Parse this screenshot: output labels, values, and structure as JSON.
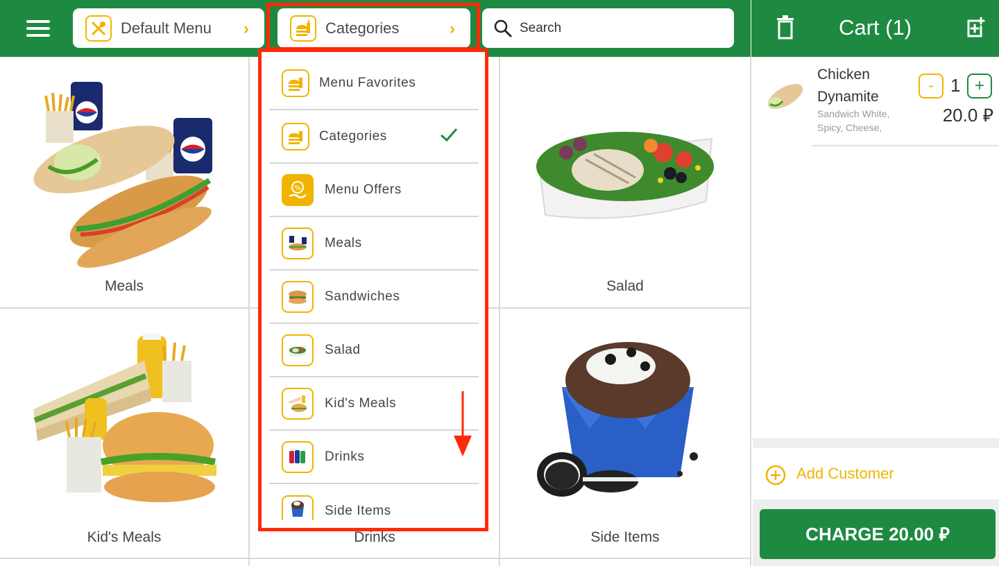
{
  "header": {
    "menu_selector": {
      "label": "Default Menu",
      "icon": "utensils-icon"
    },
    "category_selector": {
      "label": "Categories",
      "icon": "burger-drink-icon"
    },
    "search": {
      "placeholder": "Search"
    }
  },
  "cart": {
    "title": "Cart (1)",
    "items": [
      {
        "name": "Chicken Dynamite",
        "modifiers": "Sandwich White, Spicy, Cheese,",
        "quantity": "1",
        "price": "20.0 ⃁",
        "minus_label": "-",
        "plus_label": "+"
      }
    ],
    "add_customer": "Add Customer",
    "charge_label": "CHARGE 20.00 ⃁"
  },
  "tiles": [
    {
      "label": "Meals"
    },
    {
      "label": ""
    },
    {
      "label": "Salad"
    },
    {
      "label": "Kid's Meals"
    },
    {
      "label": "Drinks"
    },
    {
      "label": "Side Items"
    }
  ],
  "dropdown": {
    "items": [
      {
        "label": "Menu Favorites",
        "icon": "burger-drink-icon",
        "selected": false
      },
      {
        "label": "Categories",
        "icon": "burger-drink-icon",
        "selected": true
      },
      {
        "label": "Menu Offers",
        "icon": "percent-hand-icon",
        "selected": false
      },
      {
        "label": "Meals",
        "icon": "meals-thumb-icon",
        "selected": false
      },
      {
        "label": "Sandwiches",
        "icon": "sandwich-thumb-icon",
        "selected": false
      },
      {
        "label": "Salad",
        "icon": "salad-thumb-icon",
        "selected": false
      },
      {
        "label": "Kid's Meals",
        "icon": "kids-meal-thumb-icon",
        "selected": false
      },
      {
        "label": "Drinks",
        "icon": "drinks-thumb-icon",
        "selected": false
      },
      {
        "label": "Side Items",
        "icon": "side-items-thumb-icon",
        "selected": false
      }
    ]
  },
  "colors": {
    "brand_green": "#1e8a41",
    "accent_yellow": "#f0b400",
    "highlight_red": "#ff2a0a"
  }
}
